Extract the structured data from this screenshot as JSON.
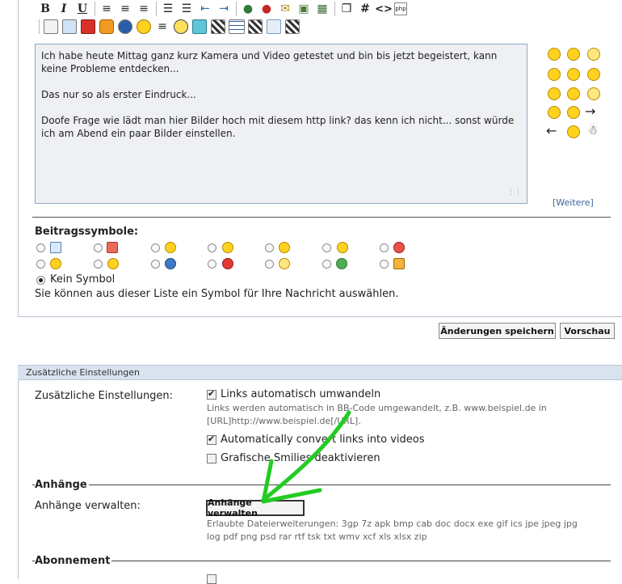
{
  "toolbar": {
    "row1": [
      {
        "icon": "bold-icon",
        "glyph": "B"
      },
      {
        "icon": "italic-icon",
        "glyph": "I"
      },
      {
        "icon": "underline-icon",
        "glyph": "U"
      },
      {
        "icon": "align-left-icon",
        "glyph": "≡"
      },
      {
        "icon": "align-center-icon",
        "glyph": "≡"
      },
      {
        "icon": "align-right-icon",
        "glyph": "≡"
      },
      {
        "icon": "ordered-list-icon",
        "glyph": "☰"
      },
      {
        "icon": "unordered-list-icon",
        "glyph": "☰"
      },
      {
        "icon": "outdent-icon",
        "glyph": "⇤"
      },
      {
        "icon": "indent-icon",
        "glyph": "⇥"
      },
      {
        "icon": "insert-link-icon",
        "glyph": "●"
      },
      {
        "icon": "remove-link-icon",
        "glyph": "●"
      },
      {
        "icon": "email-icon",
        "glyph": "✉"
      },
      {
        "icon": "insert-image-icon",
        "glyph": "▣"
      },
      {
        "icon": "insert-video-icon",
        "glyph": "▦"
      },
      {
        "icon": "quote-icon",
        "glyph": "❒"
      },
      {
        "icon": "code-hash-icon",
        "glyph": "#"
      },
      {
        "icon": "html-code-icon",
        "glyph": "<>"
      },
      {
        "icon": "php-code-icon",
        "glyph": "php"
      }
    ],
    "row2": [
      "insert-html-icon",
      "picture-upload-icon",
      "youtube-icon",
      "uw-icon",
      "play-icon",
      "warning-icon",
      "list-lines-icon",
      "lightbulb-icon",
      "zoom-box-icon",
      "qr-code-icon",
      "table-icon",
      "qr-code2-icon",
      "refresh-icon",
      "qr-code3-icon"
    ],
    "php_label": "php"
  },
  "editor": {
    "paragraphs": [
      "Ich habe heute Mittag ganz kurz Kamera und Video getestet und bin bis jetzt begeistert, kann keine Probleme entdecken...",
      "Das nur so als erster Eindruck...",
      "Doofe Frage wie lädt man hier Bilder hoch mit diesem http link? das kenn ich nicht... sonst würde ich am Abend ein paar Bilder einstellen."
    ]
  },
  "smilies": {
    "more_link": "[Weitere]",
    "colors": {
      "face": "#ffd21f",
      "outline": "#b88b00"
    }
  },
  "post_icons": {
    "title": "Beitragssymbole:",
    "none_label": "Kein Symbol",
    "hint": "Sie können aus dieser Liste ein Symbol für Ihre Nachricht auswählen."
  },
  "actions": {
    "save_changes": "Änderungen speichern",
    "preview": "Vorschau"
  },
  "additional": {
    "panel_title": "Zusätzliche Einstellungen",
    "label": "Zusätzliche Einstellungen:",
    "opt_auto_links": "Links automatisch umwandeln",
    "opt_auto_links_hint_1": "Links werden automatisch in BB-Code umgewandelt, z.B. www.beispiel.de in",
    "opt_auto_links_hint_2": "[URL]http://www.beispiel.de[/URL].",
    "opt_videos": "Automatically convert links into videos",
    "opt_disable_smilies": "Grafische Smilies deaktivieren"
  },
  "attachments": {
    "section_title": "Anhänge",
    "label": "Anhänge verwalten:",
    "button": "Anhänge verwalten",
    "ext_1": "Erlaubte Dateierweiterungen: 3gp 7z apk bmp cab doc docx exe gif ics jpe jpeg jpg",
    "ext_2": "log pdf png psd rar rtf tsk txt wmv xcf xls xlsx zip"
  },
  "subscription": {
    "section_title": "Abonnement"
  },
  "annotation": {
    "color": "#22cc22"
  }
}
